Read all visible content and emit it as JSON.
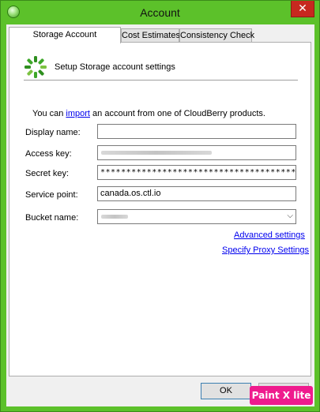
{
  "window": {
    "title": "Account",
    "close_glyph": "✕"
  },
  "tabs": [
    {
      "label": "Storage Account",
      "active": true
    },
    {
      "label": "Cost Estimates",
      "active": false
    },
    {
      "label": "Consistency Check",
      "active": false
    }
  ],
  "header": {
    "text": "Setup Storage account settings",
    "logo_icon": "cloudberry-logo-icon"
  },
  "import": {
    "prefix": "You can ",
    "link": "import",
    "suffix": " an account from one of CloudBerry products."
  },
  "form": {
    "display_name": {
      "label": "Display name:",
      "value": ""
    },
    "access_key": {
      "label": "Access key:",
      "value": ""
    },
    "secret_key": {
      "label": "Secret key:",
      "value": "****************************************"
    },
    "service_point": {
      "label": "Service point:",
      "value": "canada.os.ctl.io"
    },
    "bucket_name": {
      "label": "Bucket name:",
      "value": ""
    }
  },
  "links": {
    "advanced": "Advanced settings",
    "proxy": "Specify Proxy Settings"
  },
  "buttons": {
    "ok": "OK",
    "cancel": ""
  },
  "watermark": "Paint X lite",
  "colors": {
    "titlebar": "#5cc12a",
    "close": "#c7281f",
    "link": "#0000ee",
    "watermark": "#ef1b8d"
  }
}
